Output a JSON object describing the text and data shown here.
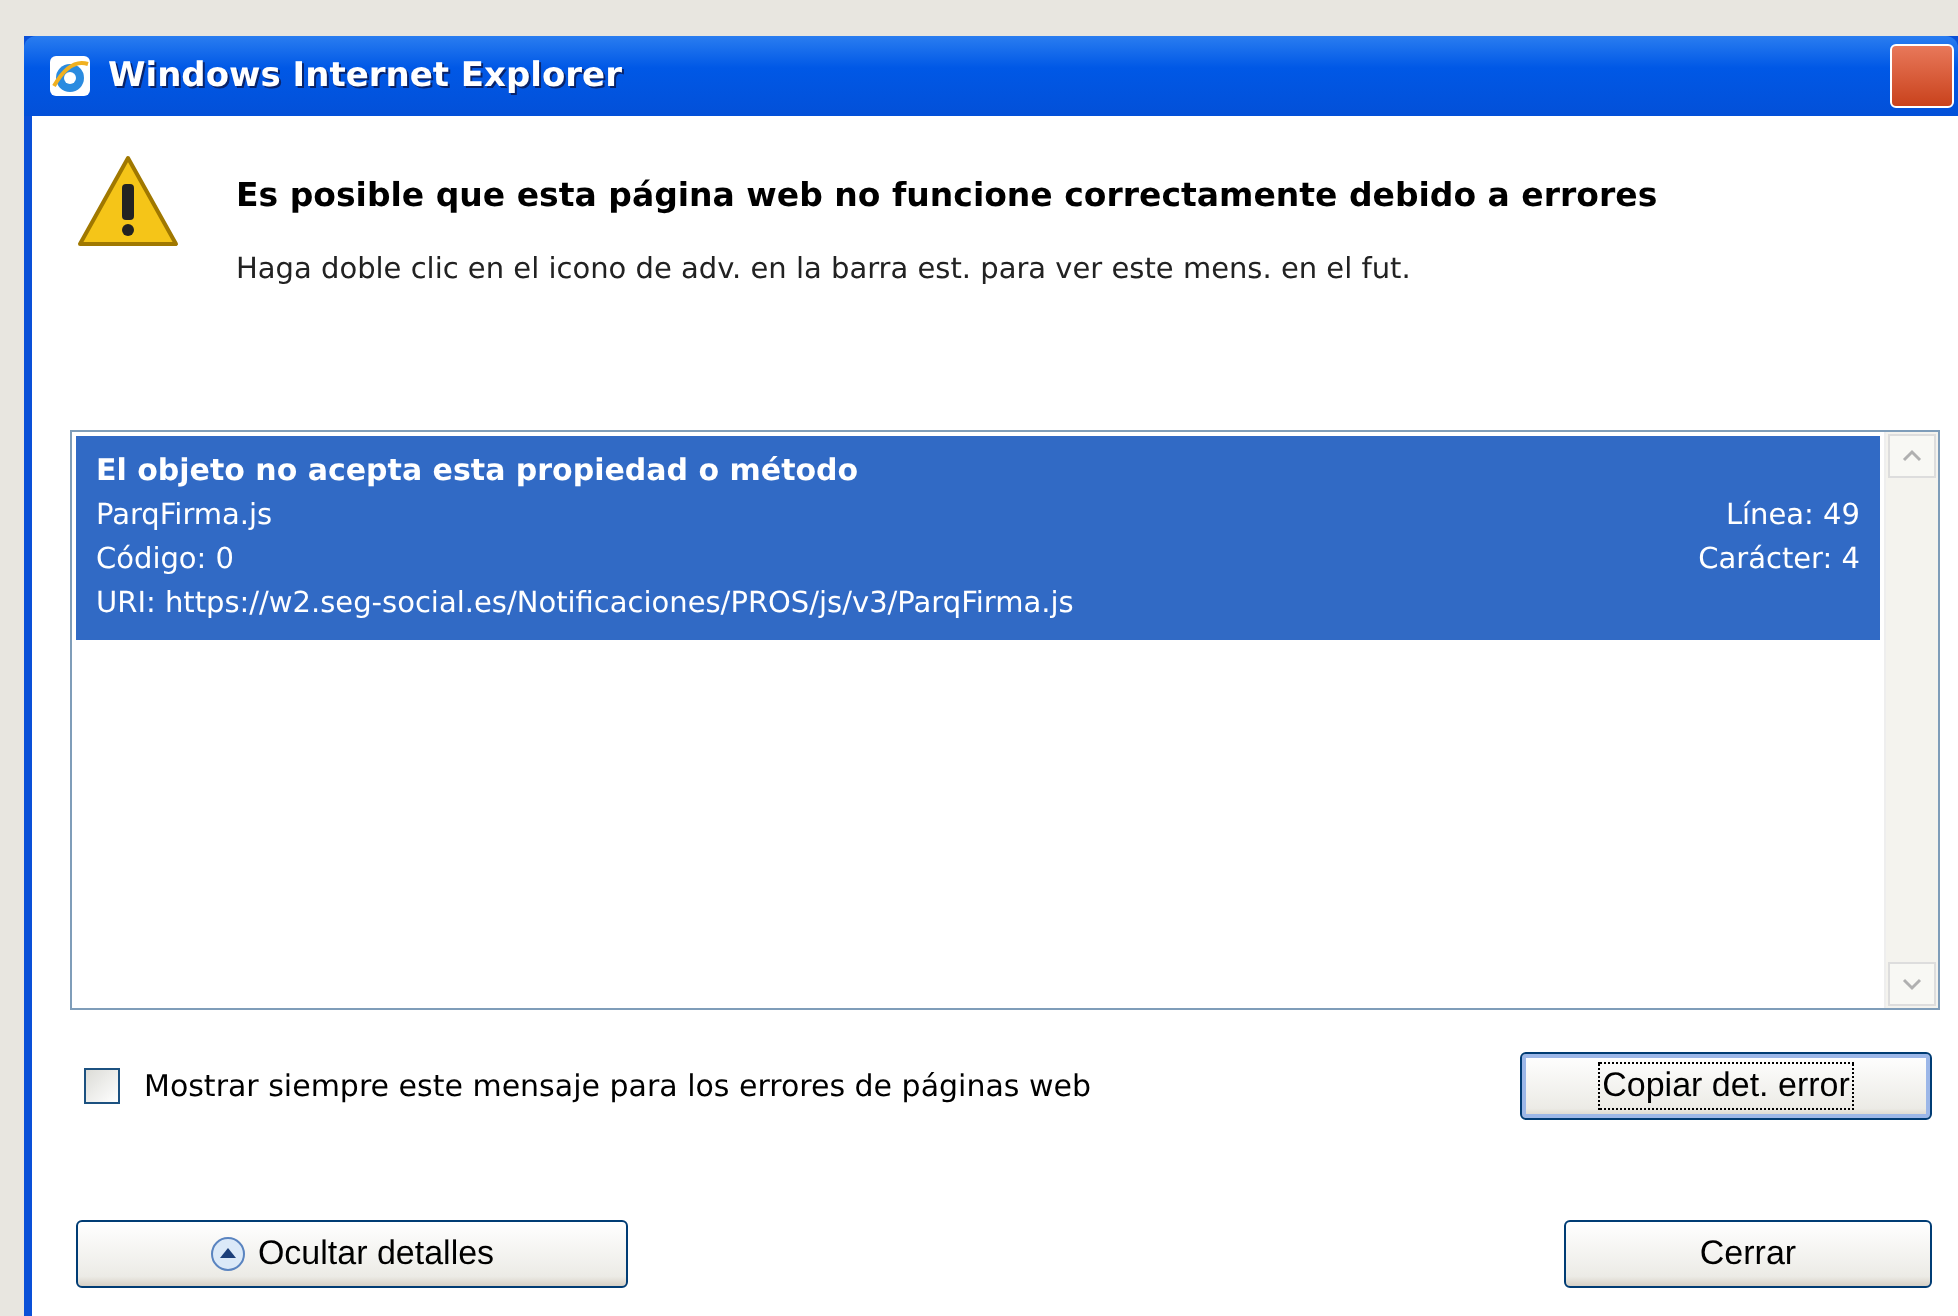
{
  "window": {
    "title": "Windows Internet Explorer"
  },
  "message": {
    "heading": "Es posible que esta página web no funcione correctamente debido a errores",
    "hint": "Haga doble clic en el icono de adv. en la barra est. para ver este mens. en el fut."
  },
  "errors": [
    {
      "selected": true,
      "title": "El objeto no acepta esta propiedad o método",
      "file": "ParqFirma.js",
      "line": "Línea: 49",
      "code": "Código: 0",
      "char": "Carácter: 4",
      "uri": "URI: https://w2.seg-social.es/Notificaciones/PROS/js/v3/ParqFirma.js"
    }
  ],
  "checkbox": {
    "label": "Mostrar siempre este mensaje para los errores de páginas web",
    "checked": false
  },
  "buttons": [
    {
      "kind": "copy",
      "label": "Copiar det. error",
      "focused": true
    },
    {
      "kind": "details",
      "label": "Ocultar detalles",
      "focused": false
    },
    {
      "kind": "close",
      "label": "Cerrar",
      "focused": false
    }
  ]
}
